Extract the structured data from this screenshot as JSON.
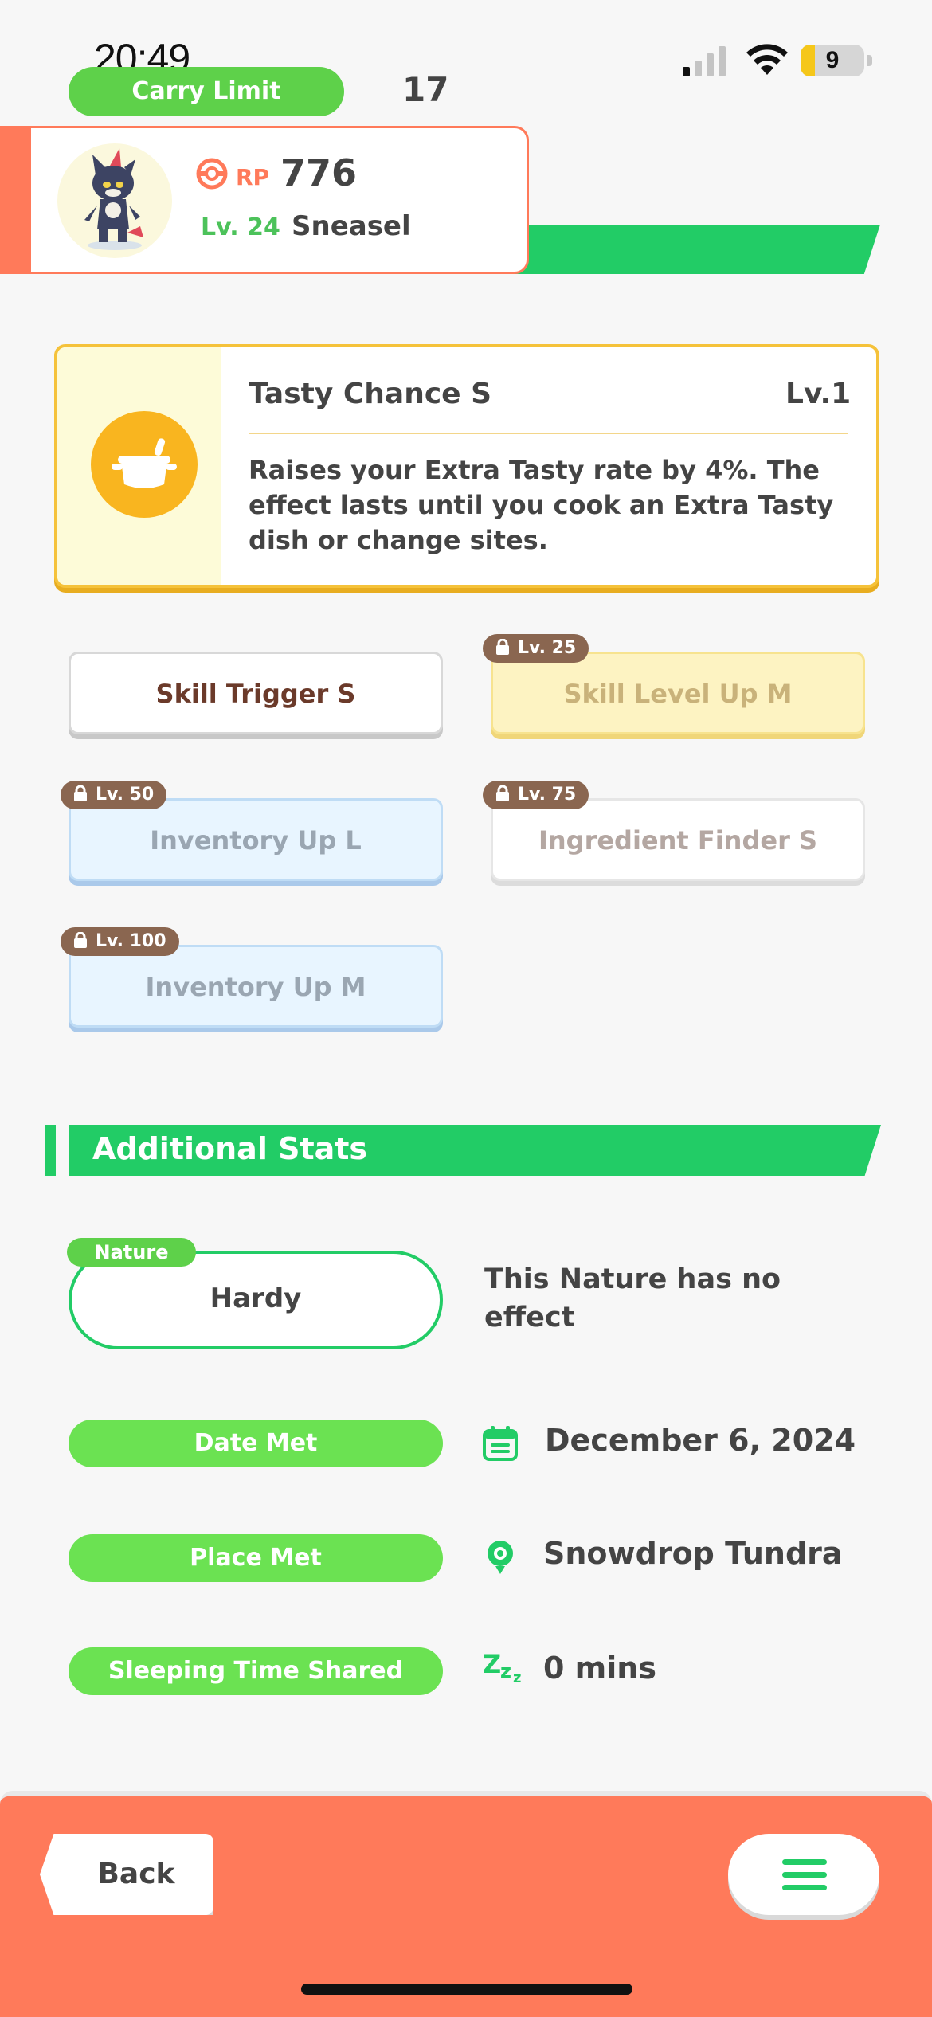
{
  "status_bar": {
    "time": "20:49",
    "battery_level": "9",
    "signal_icon": "cellular-signal-icon",
    "wifi_icon": "wifi-icon"
  },
  "header": {
    "carry_limit_label": "Carry Limit",
    "carry_limit_value": "17",
    "rp_label": "RP",
    "rp_value": "776",
    "level": "Lv. 24",
    "pokemon_name": "Sneasel"
  },
  "main_skill": {
    "name": "Tasty Chance S",
    "level": "Lv.1",
    "description": "Raises your Extra Tasty rate by 4%. The effect lasts until you cook an Extra Tasty dish or change sites.",
    "icon": "cooking-pot-icon"
  },
  "sub_skills": [
    {
      "label": "Skill Trigger S",
      "lock": "",
      "style": "white",
      "unlocked": true
    },
    {
      "label": "Skill Level Up M",
      "lock": "Lv. 25",
      "style": "gold",
      "unlocked": false
    },
    {
      "label": "Inventory Up L",
      "lock": "Lv. 50",
      "style": "blue",
      "unlocked": false
    },
    {
      "label": "Ingredient Finder S",
      "lock": "Lv. 75",
      "style": "white",
      "unlocked": false
    },
    {
      "label": "Inventory Up M",
      "lock": "Lv. 100",
      "style": "blue",
      "unlocked": false
    }
  ],
  "additional_stats": {
    "title": "Additional Stats",
    "nature_label": "Nature",
    "nature_value": "Hardy",
    "nature_desc": "This Nature has no effect",
    "date_met_label": "Date Met",
    "date_met_value": "December 6, 2024",
    "place_met_label": "Place Met",
    "place_met_value": "Snowdrop Tundra",
    "sleep_label": "Sleeping Time Shared",
    "sleep_value": "0 mins",
    "sleep_icon_text": "Zzz"
  },
  "bottom_nav": {
    "back_label": "Back",
    "menu_icon": "hamburger-menu-icon"
  },
  "colors": {
    "accent_green": "#22cc66",
    "pill_green": "#6be252",
    "orange": "#ff7a5a",
    "gold": "#f5c23a"
  }
}
